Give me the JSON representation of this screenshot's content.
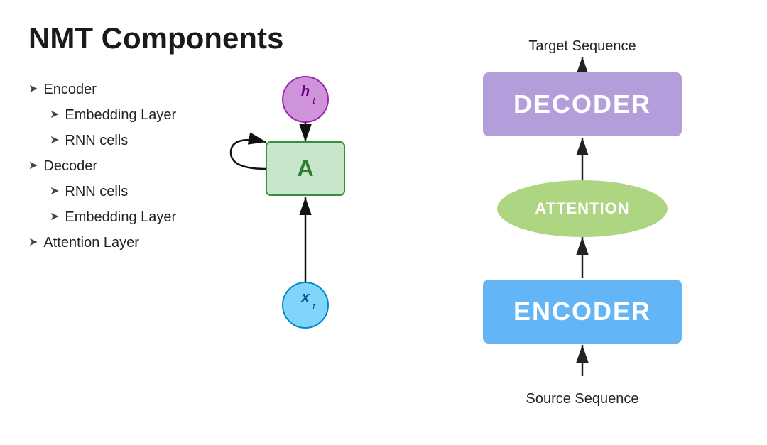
{
  "page": {
    "title": "NMT Components",
    "background": "#ffffff"
  },
  "left_panel": {
    "title": "NMT Components",
    "bullets": [
      {
        "id": "encoder",
        "text": "Encoder",
        "level": 0
      },
      {
        "id": "embedding-layer-1",
        "text": "Embedding Layer",
        "level": 1
      },
      {
        "id": "rnn-cells-1",
        "text": "RNN cells",
        "level": 1
      },
      {
        "id": "decoder",
        "text": "Decoder",
        "level": 0
      },
      {
        "id": "rnn-cells-2",
        "text": "RNN cells",
        "level": 1
      },
      {
        "id": "embedding-layer-2",
        "text": "Embedding Layer",
        "level": 1
      },
      {
        "id": "attention-layer",
        "text": "Attention Layer",
        "level": 0
      }
    ],
    "diagram": {
      "ht_label": "h",
      "ht_subscript": "t",
      "xt_label": "x",
      "xt_subscript": "t",
      "a_label": "A"
    }
  },
  "right_panel": {
    "label_top": "Target Sequence",
    "label_bottom": "Source Sequence",
    "decoder_label": "DECODER",
    "attention_label": "ATTENTION",
    "encoder_label": "ENCODER"
  },
  "colors": {
    "decoder_bg": "#b39ddb",
    "attention_bg": "#aed581",
    "encoder_bg": "#64b5f6",
    "ht_circle": "#ce93d8",
    "xt_circle": "#81d4fa",
    "a_box": "#c8e6c9"
  }
}
